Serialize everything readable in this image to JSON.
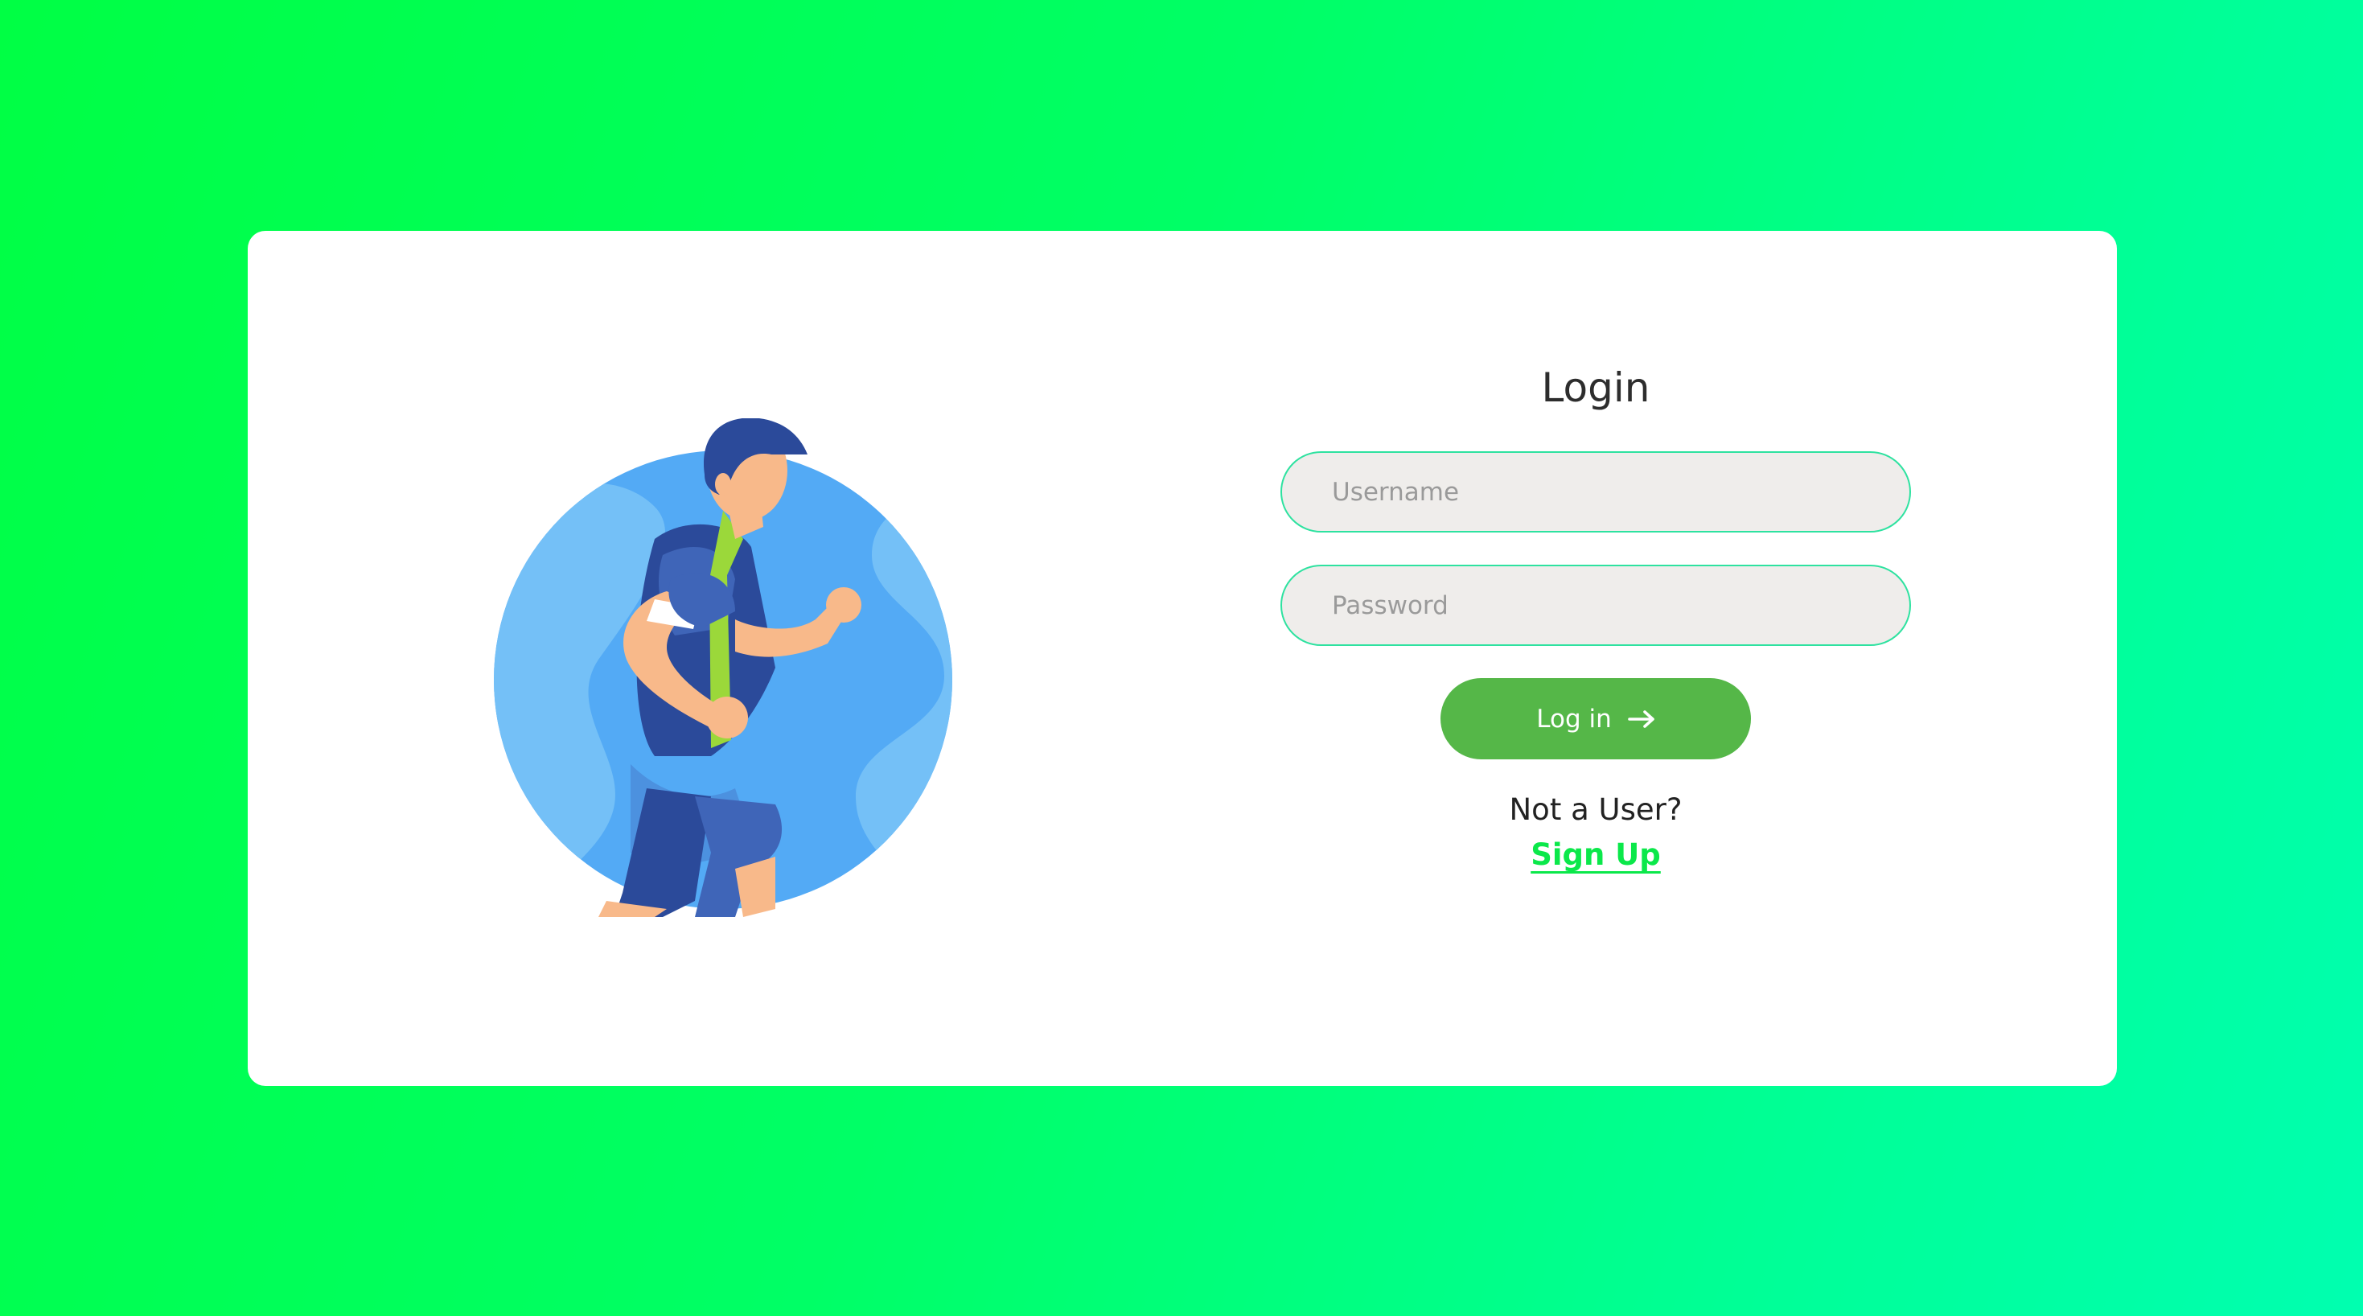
{
  "login": {
    "title": "Login",
    "username_placeholder": "Username",
    "password_placeholder": "Password",
    "button_label": "Log in",
    "button_icon": "arrow-right-icon",
    "not_user_text": "Not a User?",
    "signup_label": "Sign Up"
  },
  "colors": {
    "background_start": "#00ff44",
    "background_end": "#00ffb0",
    "card": "#ffffff",
    "button": "#55b748",
    "signup_link": "#0be84a",
    "field_border": "#2ee2a0",
    "field_fill": "#efedeb"
  }
}
